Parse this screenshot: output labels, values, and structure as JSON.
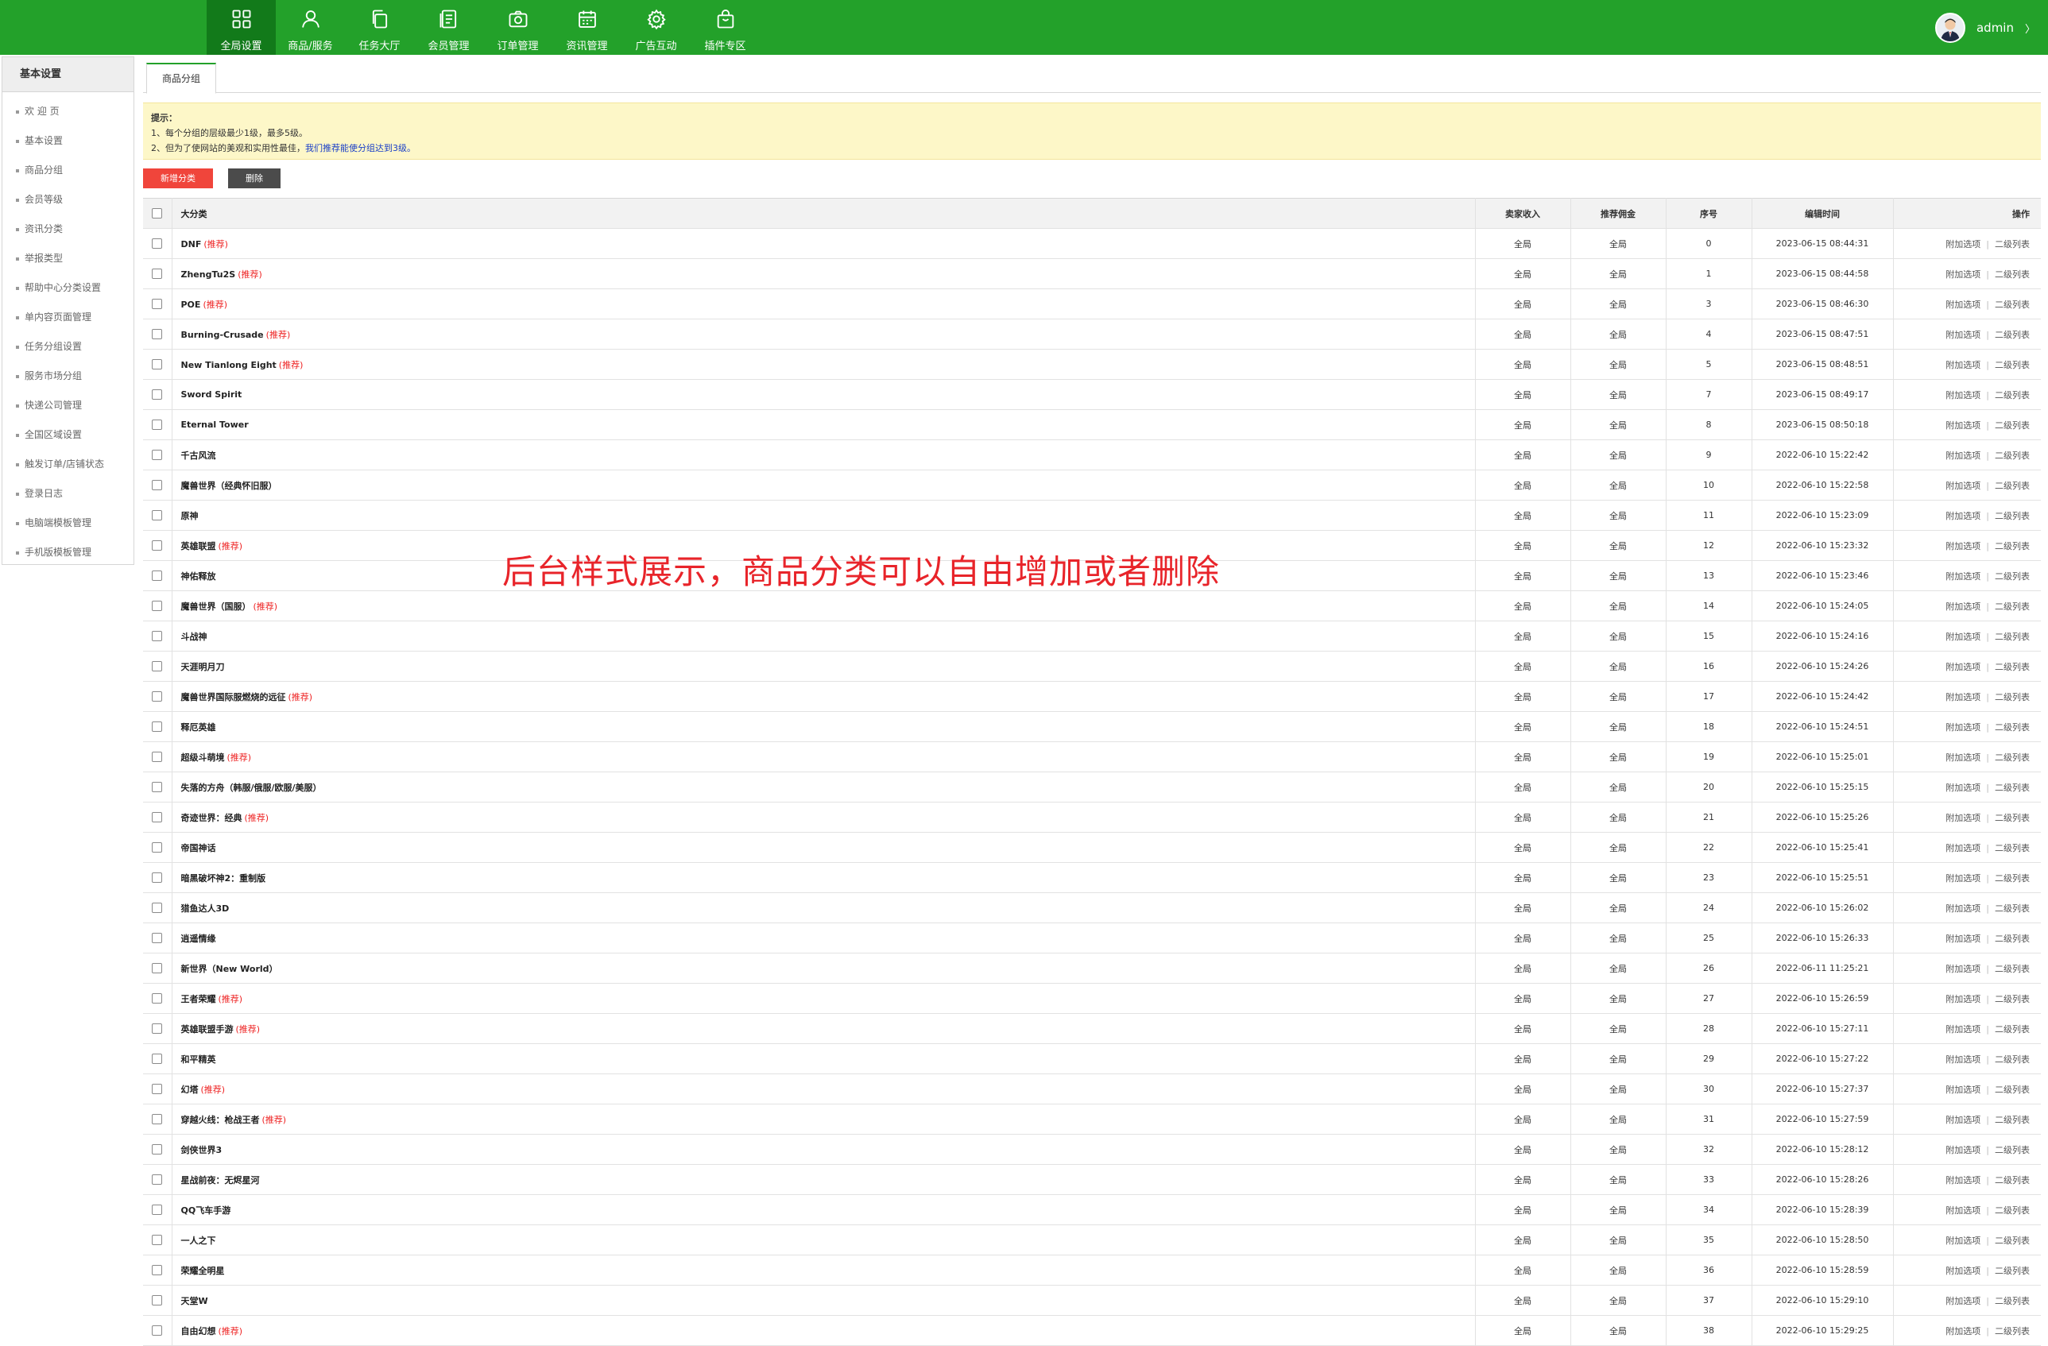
{
  "nav": {
    "items": [
      {
        "label": "全局设置",
        "icon": "grid-icon"
      },
      {
        "label": "商品/服务",
        "icon": "user-icon"
      },
      {
        "label": "任务大厅",
        "icon": "copy-icon"
      },
      {
        "label": "会员管理",
        "icon": "document-icon"
      },
      {
        "label": "订单管理",
        "icon": "camera-icon"
      },
      {
        "label": "资讯管理",
        "icon": "calendar-icon"
      },
      {
        "label": "广告互动",
        "icon": "gear-icon"
      },
      {
        "label": "插件专区",
        "icon": "bag-icon"
      }
    ],
    "active_index": 0,
    "user_name": "admin",
    "caret": "〉"
  },
  "sidebar": {
    "title": "基本设置",
    "items": [
      "欢 迎 页",
      "基本设置",
      "商品分组",
      "会员等级",
      "资讯分类",
      "举报类型",
      "帮助中心分类设置",
      "单内容页面管理",
      "任务分组设置",
      "服务市场分组",
      "快递公司管理",
      "全国区域设置",
      "触发订单/店铺状态",
      "登录日志",
      "电脑端模板管理",
      "手机版模板管理"
    ]
  },
  "tab": {
    "label": "商品分组"
  },
  "tips": {
    "title": "提示：",
    "line1": "1、每个分组的层级最少1级，最多5级。",
    "line2_prefix": "2、但为了使网站的美观和实用性最佳，",
    "line2_link": "我们推荐能使分组达到3级。"
  },
  "actions": {
    "add_label": "新增分类",
    "delete_label": "删除"
  },
  "table": {
    "headers": {
      "name": "大分类",
      "seller_income": "卖家收入",
      "commission": "推荐佣金",
      "order": "序号",
      "edit_time": "编辑时间",
      "ops": "操作"
    },
    "tag_label": "(推荐)",
    "op1": "附加选项",
    "op2": "二级列表",
    "rows": [
      {
        "name": "DNF",
        "rec": true,
        "a": "全局",
        "b": "全局",
        "order": "0",
        "time": "2023-06-15 08:44:31"
      },
      {
        "name": "ZhengTu2S",
        "rec": true,
        "a": "全局",
        "b": "全局",
        "order": "1",
        "time": "2023-06-15 08:44:58"
      },
      {
        "name": "POE",
        "rec": true,
        "a": "全局",
        "b": "全局",
        "order": "3",
        "time": "2023-06-15 08:46:30"
      },
      {
        "name": "Burning-Crusade",
        "rec": true,
        "a": "全局",
        "b": "全局",
        "order": "4",
        "time": "2023-06-15 08:47:51"
      },
      {
        "name": "New Tianlong Eight",
        "rec": true,
        "a": "全局",
        "b": "全局",
        "order": "5",
        "time": "2023-06-15 08:48:51"
      },
      {
        "name": "Sword Spirit",
        "rec": false,
        "a": "全局",
        "b": "全局",
        "order": "7",
        "time": "2023-06-15 08:49:17"
      },
      {
        "name": "Eternal Tower",
        "rec": false,
        "a": "全局",
        "b": "全局",
        "order": "8",
        "time": "2023-06-15 08:50:18"
      },
      {
        "name": "千古风流",
        "rec": false,
        "a": "全局",
        "b": "全局",
        "order": "9",
        "time": "2022-06-10 15:22:42"
      },
      {
        "name": "魔兽世界（经典怀旧服）",
        "rec": false,
        "a": "全局",
        "b": "全局",
        "order": "10",
        "time": "2022-06-10 15:22:58"
      },
      {
        "name": "原神",
        "rec": false,
        "a": "全局",
        "b": "全局",
        "order": "11",
        "time": "2022-06-10 15:23:09"
      },
      {
        "name": "英雄联盟",
        "rec": true,
        "a": "全局",
        "b": "全局",
        "order": "12",
        "time": "2022-06-10 15:23:32"
      },
      {
        "name": "神佑释放",
        "rec": false,
        "a": "全局",
        "b": "全局",
        "order": "13",
        "time": "2022-06-10 15:23:46"
      },
      {
        "name": "魔兽世界（国服）",
        "rec": true,
        "a": "全局",
        "b": "全局",
        "order": "14",
        "time": "2022-06-10 15:24:05"
      },
      {
        "name": "斗战神",
        "rec": false,
        "a": "全局",
        "b": "全局",
        "order": "15",
        "time": "2022-06-10 15:24:16"
      },
      {
        "name": "天涯明月刀",
        "rec": false,
        "a": "全局",
        "b": "全局",
        "order": "16",
        "time": "2022-06-10 15:24:26"
      },
      {
        "name": "魔兽世界国际服燃烧的远征",
        "rec": true,
        "a": "全局",
        "b": "全局",
        "order": "17",
        "time": "2022-06-10 15:24:42"
      },
      {
        "name": "释厄英雄",
        "rec": false,
        "a": "全局",
        "b": "全局",
        "order": "18",
        "time": "2022-06-10 15:24:51"
      },
      {
        "name": "超级斗萌境",
        "rec": true,
        "a": "全局",
        "b": "全局",
        "order": "19",
        "time": "2022-06-10 15:25:01"
      },
      {
        "name": "失落的方舟（韩服/俄服/欧服/美服）",
        "rec": false,
        "a": "全局",
        "b": "全局",
        "order": "20",
        "time": "2022-06-10 15:25:15"
      },
      {
        "name": "奇迹世界：经典",
        "rec": true,
        "a": "全局",
        "b": "全局",
        "order": "21",
        "time": "2022-06-10 15:25:26"
      },
      {
        "name": "帝国神话",
        "rec": false,
        "a": "全局",
        "b": "全局",
        "order": "22",
        "time": "2022-06-10 15:25:41"
      },
      {
        "name": "暗黑破坏神2：重制版",
        "rec": false,
        "a": "全局",
        "b": "全局",
        "order": "23",
        "time": "2022-06-10 15:25:51"
      },
      {
        "name": "猎鱼达人3D",
        "rec": false,
        "a": "全局",
        "b": "全局",
        "order": "24",
        "time": "2022-06-10 15:26:02"
      },
      {
        "name": "逍遥情缘",
        "rec": false,
        "a": "全局",
        "b": "全局",
        "order": "25",
        "time": "2022-06-10 15:26:33"
      },
      {
        "name": "新世界（New World）",
        "rec": false,
        "a": "全局",
        "b": "全局",
        "order": "26",
        "time": "2022-06-11 11:25:21"
      },
      {
        "name": "王者荣耀",
        "rec": true,
        "a": "全局",
        "b": "全局",
        "order": "27",
        "time": "2022-06-10 15:26:59"
      },
      {
        "name": "英雄联盟手游",
        "rec": true,
        "a": "全局",
        "b": "全局",
        "order": "28",
        "time": "2022-06-10 15:27:11"
      },
      {
        "name": "和平精英",
        "rec": false,
        "a": "全局",
        "b": "全局",
        "order": "29",
        "time": "2022-06-10 15:27:22"
      },
      {
        "name": "幻塔",
        "rec": true,
        "a": "全局",
        "b": "全局",
        "order": "30",
        "time": "2022-06-10 15:27:37"
      },
      {
        "name": "穿越火线：枪战王者",
        "rec": true,
        "a": "全局",
        "b": "全局",
        "order": "31",
        "time": "2022-06-10 15:27:59"
      },
      {
        "name": "剑侠世界3",
        "rec": false,
        "a": "全局",
        "b": "全局",
        "order": "32",
        "time": "2022-06-10 15:28:12"
      },
      {
        "name": "星战前夜：无烬星河",
        "rec": false,
        "a": "全局",
        "b": "全局",
        "order": "33",
        "time": "2022-06-10 15:28:26"
      },
      {
        "name": "QQ飞车手游",
        "rec": false,
        "a": "全局",
        "b": "全局",
        "order": "34",
        "time": "2022-06-10 15:28:39"
      },
      {
        "name": "一人之下",
        "rec": false,
        "a": "全局",
        "b": "全局",
        "order": "35",
        "time": "2022-06-10 15:28:50"
      },
      {
        "name": "荣耀全明星",
        "rec": false,
        "a": "全局",
        "b": "全局",
        "order": "36",
        "time": "2022-06-10 15:28:59"
      },
      {
        "name": "天堂W",
        "rec": false,
        "a": "全局",
        "b": "全局",
        "order": "37",
        "time": "2022-06-10 15:29:10"
      },
      {
        "name": "自由幻想",
        "rec": true,
        "a": "全局",
        "b": "全局",
        "order": "38",
        "time": "2022-06-10 15:29:25"
      }
    ]
  },
  "overlay_caption": "后台样式展示，商品分类可以自由增加或者删除",
  "colors": {
    "header_green": "#23a12a",
    "active_nav": "#127a1a",
    "add_button": "#f0453b",
    "delete_button": "#4b4b4b",
    "tips_bg": "#fdf7c8",
    "tag_red": "#e22222"
  }
}
